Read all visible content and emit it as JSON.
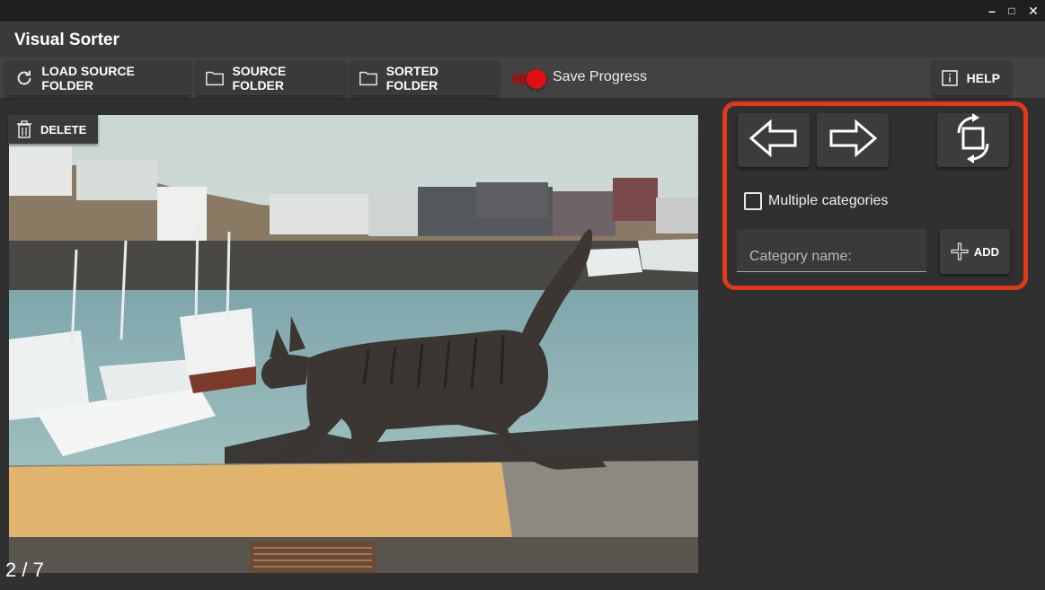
{
  "window": {
    "minimize": "–",
    "maximize": "□",
    "close": "✕"
  },
  "app": {
    "title": "Visual Sorter"
  },
  "toolbar": {
    "load_source": "LOAD SOURCE FOLDER",
    "source_folder": "SOURCE FOLDER",
    "sorted_folder": "SORTED FOLDER",
    "save_progress": "Save Progress",
    "save_progress_on": true,
    "help": "HELP"
  },
  "viewer": {
    "delete_label": "DELETE",
    "counter": "2 / 7"
  },
  "panel": {
    "multiple_categories": "Multiple categories",
    "multiple_categories_checked": false,
    "category_placeholder": "Category name:",
    "category_value": "",
    "add_label": "ADD"
  },
  "colors": {
    "accent_red": "#e0391b",
    "toggle_red": "#e01010",
    "background": "#303030"
  },
  "icons": [
    "refresh-icon",
    "folder-icon",
    "info-icon",
    "trash-icon",
    "arrow-left-icon",
    "arrow-right-icon",
    "rotate-icon",
    "plus-icon"
  ]
}
